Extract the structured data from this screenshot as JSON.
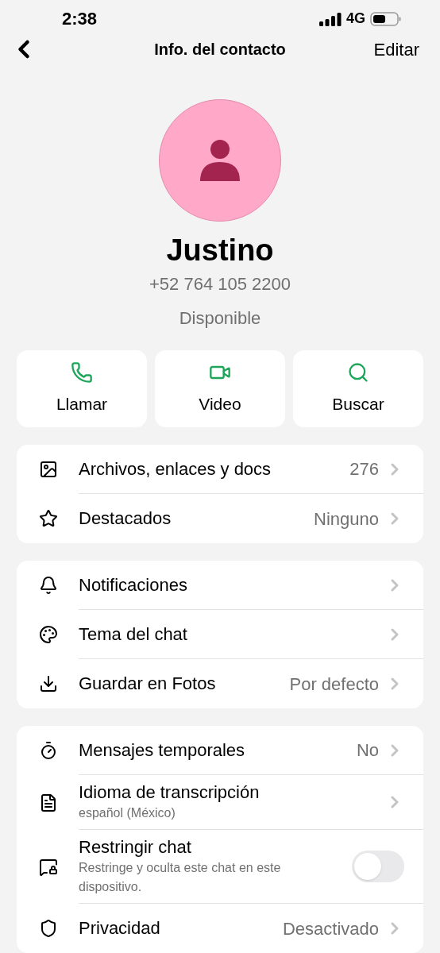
{
  "status_bar": {
    "time": "2:38",
    "network": "4G"
  },
  "nav": {
    "title": "Info. del contacto",
    "action": "Editar"
  },
  "contact": {
    "name": "Justino",
    "phone": "+52 764 105 2200",
    "status": "Disponible"
  },
  "actions": [
    {
      "label": "Llamar"
    },
    {
      "label": "Video"
    },
    {
      "label": "Buscar"
    }
  ],
  "sections": [
    {
      "rows": [
        {
          "kind": "link",
          "label": "Archivos, enlaces y docs",
          "value": "276"
        },
        {
          "kind": "link",
          "label": "Destacados",
          "value": "Ninguno"
        }
      ]
    },
    {
      "rows": [
        {
          "kind": "link",
          "label": "Notificaciones"
        },
        {
          "kind": "link",
          "label": "Tema del chat"
        },
        {
          "kind": "link",
          "label": "Guardar en Fotos",
          "value": "Por defecto"
        }
      ]
    },
    {
      "rows": [
        {
          "kind": "link",
          "label": "Mensajes temporales",
          "value": "No"
        },
        {
          "kind": "link",
          "label": "Idioma de transcripción",
          "subtitle": "español (México)"
        },
        {
          "kind": "toggle",
          "label": "Restringir chat",
          "subtitle": "Restringe y oculta este chat en este dispositivo.",
          "on": false
        },
        {
          "kind": "link",
          "label": "Privacidad",
          "value": "Desactivado"
        }
      ]
    }
  ]
}
